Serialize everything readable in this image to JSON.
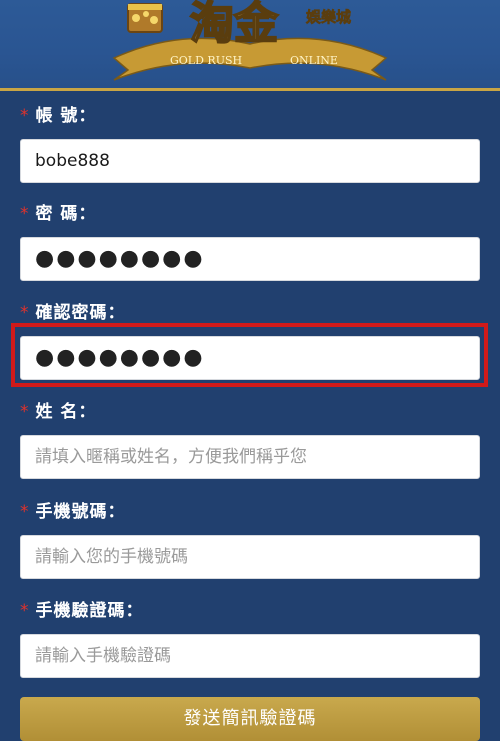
{
  "header": {
    "logo_main": "淘金",
    "logo_side": "娛樂城",
    "logo_ribbon_left": "GOLD RUSH",
    "logo_ribbon_right": "ONLINE"
  },
  "form": {
    "account": {
      "label": "帳 號：",
      "value": "bobe888"
    },
    "password": {
      "label": "密 碼：",
      "value": "●●●●●●●●"
    },
    "confirm_password": {
      "label": "確認密碼：",
      "value": "●●●●●●●●"
    },
    "name": {
      "label": "姓 名：",
      "placeholder": "請填入暱稱或姓名，方便我們稱乎您"
    },
    "mobile": {
      "label": "手機號碼：",
      "placeholder": "請輸入您的手機號碼"
    },
    "sms_code": {
      "label": "手機驗證碼：",
      "placeholder": "請輸入手機驗證碼"
    },
    "required_mark": "*"
  },
  "buttons": {
    "send_sms": "發送簡訊驗證碼"
  },
  "colors": {
    "background": "#21406f",
    "required": "#e0322c",
    "highlight": "#d11a1a",
    "button": "#c2a244"
  }
}
